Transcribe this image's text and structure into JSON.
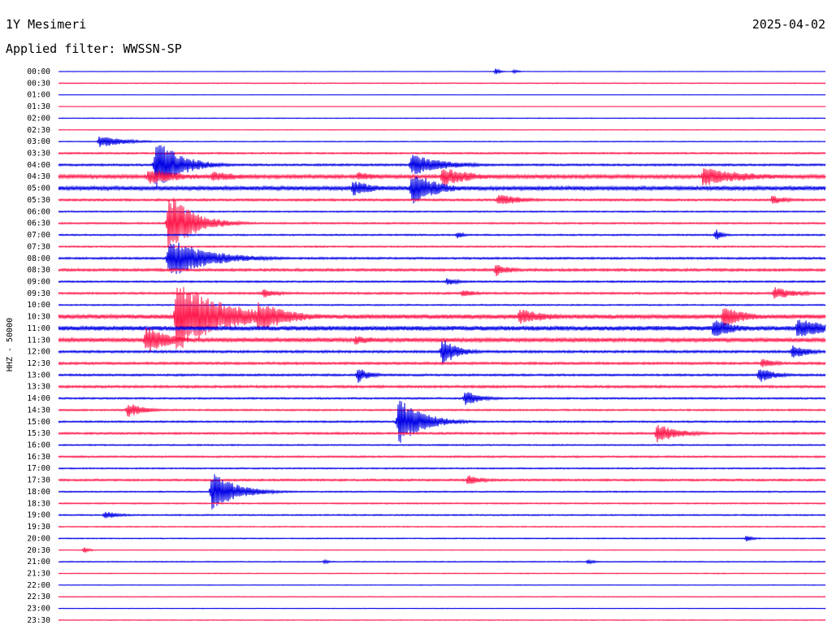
{
  "header": {
    "station": "1Y Mesimeri",
    "date": "2025-04-02",
    "filter_label": "Applied filter: WWSSN-SP"
  },
  "colors": {
    "even_trace": "#0000e6",
    "odd_trace": "#ff1a4d"
  },
  "chart_data": {
    "type": "line",
    "title": "1Y Mesimeri",
    "ylabel": "HHZ - 50000",
    "row_labels": [
      "00:00",
      "00:30",
      "01:00",
      "01:30",
      "02:00",
      "02:30",
      "03:00",
      "03:30",
      "04:00",
      "04:30",
      "05:00",
      "05:30",
      "06:00",
      "06:30",
      "07:00",
      "07:30",
      "08:00",
      "08:30",
      "09:00",
      "09:30",
      "10:00",
      "10:30",
      "11:00",
      "11:30",
      "12:00",
      "12:30",
      "13:00",
      "13:30",
      "14:00",
      "14:30",
      "15:00",
      "15:30",
      "16:00",
      "16:30",
      "17:00",
      "17:30",
      "18:00",
      "18:30",
      "19:00",
      "19:30",
      "20:00",
      "20:30",
      "21:00",
      "21:30",
      "22:00",
      "22:30",
      "23:00",
      "23:30"
    ],
    "row_duration_minutes": 30,
    "noise_level": [
      0.3,
      0.6,
      0.2,
      0.3,
      0.5,
      0.4,
      0.5,
      1.0,
      1.2,
      2.2,
      2.4,
      1.3,
      0.8,
      1.0,
      0.9,
      0.9,
      1.2,
      1.5,
      1.0,
      1.2,
      0.8,
      2.6,
      2.8,
      2.4,
      1.4,
      1.4,
      1.2,
      1.4,
      1.0,
      1.0,
      1.0,
      1.2,
      0.8,
      1.0,
      0.8,
      1.2,
      0.8,
      0.8,
      0.8,
      0.6,
      0.6,
      0.4,
      0.6,
      0.5,
      0.4,
      0.5,
      0.4,
      0.5
    ],
    "events": [
      {
        "row": 0,
        "minute": 17.1,
        "amp": 4,
        "dur": 0.3
      },
      {
        "row": 0,
        "minute": 17.8,
        "amp": 3,
        "dur": 0.3
      },
      {
        "row": 6,
        "minute": 1.6,
        "amp": 8,
        "dur": 1.5
      },
      {
        "row": 8,
        "minute": 3.8,
        "amp": 35,
        "dur": 1.5
      },
      {
        "row": 8,
        "minute": 13.8,
        "amp": 14,
        "dur": 2.0
      },
      {
        "row": 9,
        "minute": 3.5,
        "amp": 10,
        "dur": 2.5
      },
      {
        "row": 9,
        "minute": 6.0,
        "amp": 7,
        "dur": 2.0
      },
      {
        "row": 9,
        "minute": 11.7,
        "amp": 6,
        "dur": 1.5
      },
      {
        "row": 9,
        "minute": 15.0,
        "amp": 12,
        "dur": 2.0
      },
      {
        "row": 9,
        "minute": 25.2,
        "amp": 12,
        "dur": 3.0
      },
      {
        "row": 10,
        "minute": 11.5,
        "amp": 10,
        "dur": 1.5
      },
      {
        "row": 10,
        "minute": 13.8,
        "amp": 22,
        "dur": 1.5
      },
      {
        "row": 11,
        "minute": 17.2,
        "amp": 8,
        "dur": 1.5
      },
      {
        "row": 11,
        "minute": 27.9,
        "amp": 6,
        "dur": 1.0
      },
      {
        "row": 13,
        "minute": 4.3,
        "amp": 40,
        "dur": 1.5
      },
      {
        "row": 14,
        "minute": 15.6,
        "amp": 5,
        "dur": 0.4
      },
      {
        "row": 14,
        "minute": 25.7,
        "amp": 8,
        "dur": 0.4
      },
      {
        "row": 16,
        "minute": 4.3,
        "amp": 25,
        "dur": 2.5
      },
      {
        "row": 17,
        "minute": 17.1,
        "amp": 8,
        "dur": 1.0
      },
      {
        "row": 18,
        "minute": 15.2,
        "amp": 5,
        "dur": 0.8
      },
      {
        "row": 19,
        "minute": 8.0,
        "amp": 6,
        "dur": 1.0
      },
      {
        "row": 19,
        "minute": 15.8,
        "amp": 5,
        "dur": 1.0
      },
      {
        "row": 19,
        "minute": 28.0,
        "amp": 8,
        "dur": 1.5
      },
      {
        "row": 21,
        "minute": 4.6,
        "amp": 45,
        "dur": 3.0
      },
      {
        "row": 21,
        "minute": 7.8,
        "amp": 20,
        "dur": 2.0
      },
      {
        "row": 21,
        "minute": 18.0,
        "amp": 10,
        "dur": 2.0
      },
      {
        "row": 21,
        "minute": 26.0,
        "amp": 14,
        "dur": 1.5
      },
      {
        "row": 22,
        "minute": 25.6,
        "amp": 12,
        "dur": 1.5
      },
      {
        "row": 22,
        "minute": 28.9,
        "amp": 14,
        "dur": 2.0
      },
      {
        "row": 23,
        "minute": 3.4,
        "amp": 18,
        "dur": 1.5
      },
      {
        "row": 23,
        "minute": 11.6,
        "amp": 6,
        "dur": 1.5
      },
      {
        "row": 24,
        "minute": 15.0,
        "amp": 18,
        "dur": 1.0
      },
      {
        "row": 24,
        "minute": 28.7,
        "amp": 10,
        "dur": 1.0
      },
      {
        "row": 25,
        "minute": 27.5,
        "amp": 6,
        "dur": 1.0
      },
      {
        "row": 26,
        "minute": 11.7,
        "amp": 10,
        "dur": 0.8
      },
      {
        "row": 26,
        "minute": 27.4,
        "amp": 10,
        "dur": 1.0
      },
      {
        "row": 28,
        "minute": 15.9,
        "amp": 10,
        "dur": 1.0
      },
      {
        "row": 29,
        "minute": 2.7,
        "amp": 10,
        "dur": 1.0
      },
      {
        "row": 30,
        "minute": 13.3,
        "amp": 30,
        "dur": 1.5
      },
      {
        "row": 31,
        "minute": 23.4,
        "amp": 12,
        "dur": 1.5
      },
      {
        "row": 35,
        "minute": 16.0,
        "amp": 7,
        "dur": 1.0
      },
      {
        "row": 36,
        "minute": 6.0,
        "amp": 25,
        "dur": 1.5
      },
      {
        "row": 38,
        "minute": 1.8,
        "amp": 5,
        "dur": 1.0
      },
      {
        "row": 40,
        "minute": 26.9,
        "amp": 4,
        "dur": 0.5
      },
      {
        "row": 41,
        "minute": 1.0,
        "amp": 5,
        "dur": 0.3
      },
      {
        "row": 42,
        "minute": 10.4,
        "amp": 3,
        "dur": 0.3
      },
      {
        "row": 42,
        "minute": 20.7,
        "amp": 3,
        "dur": 0.5
      }
    ]
  }
}
